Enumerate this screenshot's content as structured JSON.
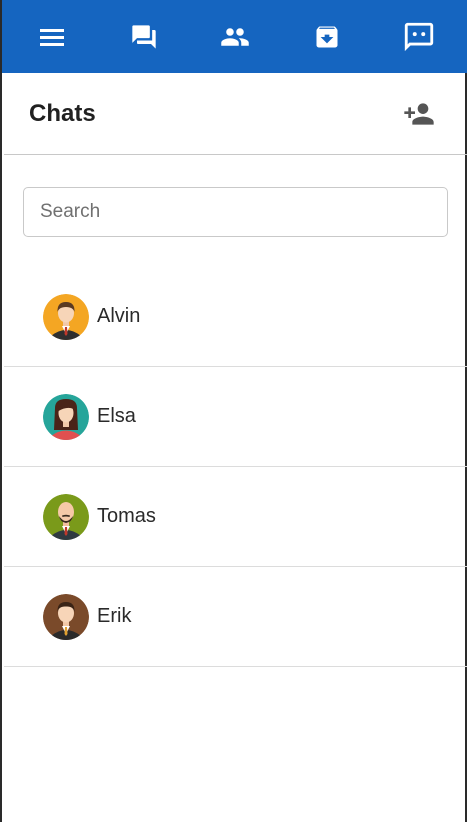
{
  "topbar": {
    "icons": [
      {
        "name": "menu-icon"
      },
      {
        "name": "chats-icon"
      },
      {
        "name": "contacts-icon"
      },
      {
        "name": "archive-icon"
      },
      {
        "name": "new-message-icon"
      }
    ],
    "bg": "#1565c0"
  },
  "header": {
    "title": "Chats",
    "add_icon": "person-add-icon"
  },
  "search": {
    "placeholder": "Search",
    "value": ""
  },
  "chats": [
    {
      "name": "Alvin",
      "avatar_bg": "#f4a623"
    },
    {
      "name": "Elsa",
      "avatar_bg": "#26a59a"
    },
    {
      "name": "Tomas",
      "avatar_bg": "#7a9a1a"
    },
    {
      "name": "Erik",
      "avatar_bg": "#7a4a2a"
    }
  ]
}
